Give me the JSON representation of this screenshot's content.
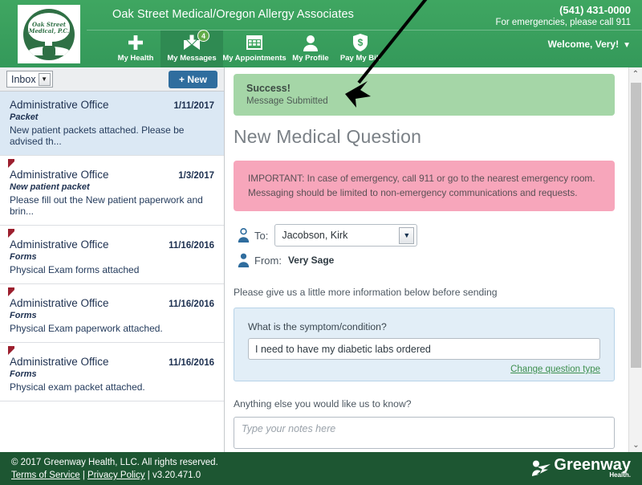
{
  "header": {
    "clinic_title": "Oak Street Medical/Oregon Allergy Associates",
    "phone": "(541) 431-0000",
    "emergency_note": "For emergencies, please call 911",
    "welcome": "Welcome, Very!",
    "welcome_caret": "▼",
    "logo_seal_text": "Oak Street\nMedical, P.C.",
    "nav": [
      {
        "label": "My Health",
        "icon": "plus-icon",
        "active": false,
        "badge": ""
      },
      {
        "label": "My Messages",
        "icon": "envelope-download-icon",
        "active": true,
        "badge": "4"
      },
      {
        "label": "My Appointments",
        "icon": "calendar-icon",
        "active": false,
        "badge": ""
      },
      {
        "label": "My Profile",
        "icon": "person-icon",
        "active": false,
        "badge": ""
      },
      {
        "label": "Pay My Bill",
        "icon": "dollar-shield-icon",
        "active": false,
        "badge": ""
      }
    ]
  },
  "sidebar": {
    "folder_selected": "Inbox",
    "folder_caret": "▼",
    "new_button": "+ New",
    "messages": [
      {
        "from": "Administrative Office",
        "date": "1/11/2017",
        "subject": "Packet",
        "preview": "New patient packets attached. Please be advised th...",
        "selected": true,
        "flagged": false
      },
      {
        "from": "Administrative Office",
        "date": "1/3/2017",
        "subject": "New patient packet",
        "preview": "Please fill out the New patient paperwork and brin...",
        "selected": false,
        "flagged": true
      },
      {
        "from": "Administrative Office",
        "date": "11/16/2016",
        "subject": "Forms",
        "preview": "Physical Exam forms attached",
        "selected": false,
        "flagged": true
      },
      {
        "from": "Administrative Office",
        "date": "11/16/2016",
        "subject": "Forms",
        "preview": "Physical Exam paperwork attached.",
        "selected": false,
        "flagged": true
      },
      {
        "from": "Administrative Office",
        "date": "11/16/2016",
        "subject": "Forms",
        "preview": "Physical exam packet attached.",
        "selected": false,
        "flagged": true
      }
    ]
  },
  "main": {
    "success_title": "Success!",
    "success_subtitle": "Message Submitted",
    "page_title": "New Medical Question",
    "warning_line1": "IMPORTANT: In case of emergency, call 911 or go to the nearest emergency room.",
    "warning_line2": "Messaging should be limited to non-emergency communications and requests.",
    "to_label": "To:",
    "to_value": "Jacobson, Kirk",
    "to_caret": "▼",
    "from_label": "From:",
    "from_value": "Very Sage",
    "hint": "Please give us a little more information below before sending",
    "question_label": "What is the symptom/condition?",
    "question_value": "I need to have my diabetic labs ordered",
    "change_question_link": "Change question type",
    "notes_label": "Anything else you would like us to know?",
    "notes_placeholder": "Type your notes here",
    "scroll_up": "⌃",
    "scroll_down": "⌄"
  },
  "footer": {
    "copyright": "© 2017 Greenway Health, LLC. All rights reserved.",
    "terms": "Terms of Service",
    "sep1": " | ",
    "privacy": "Privacy Policy",
    "sep2": " | ",
    "version": "v3.20.471.0",
    "brand": "Greenway",
    "brand_sub": "Health."
  },
  "annotation": {
    "type": "arrow",
    "description": "black arrow pointing down-left at the success banner"
  },
  "colors": {
    "header_green": "#3ea45f",
    "active_nav_green": "#2f8a52",
    "footer_green": "#1d5632",
    "success_green": "#a5d6a7",
    "warning_pink": "#f7a6bb",
    "link_green": "#3d8f4e",
    "new_button_blue": "#2f6d9e",
    "selected_row_blue": "#dbe8f4",
    "flag_red": "#9c1f2e",
    "question_box_blue": "#e2eef7"
  }
}
